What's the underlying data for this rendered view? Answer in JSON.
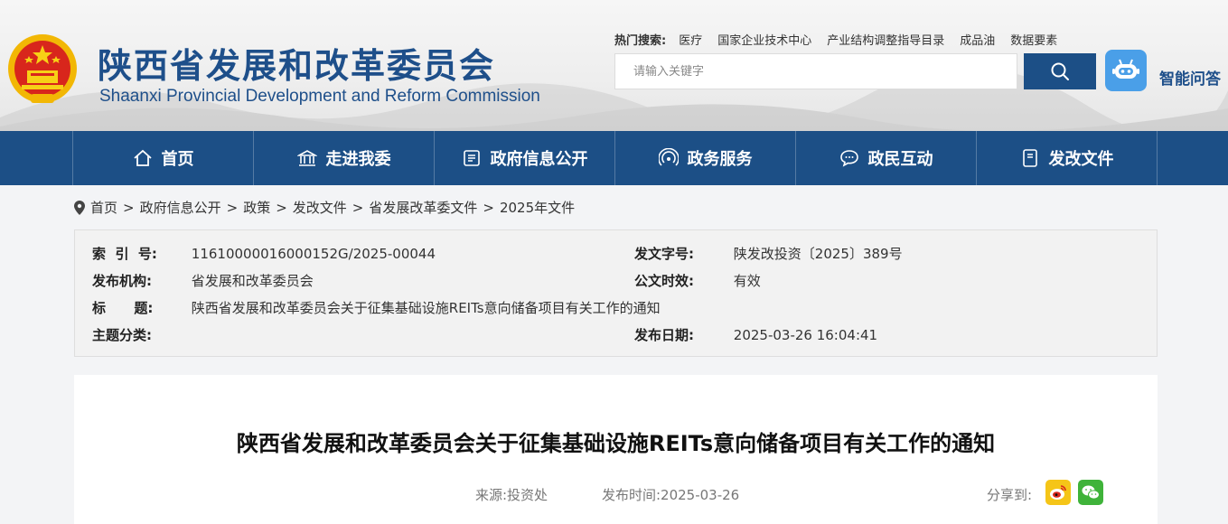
{
  "header": {
    "title_cn": "陕西省发展和改革委员会",
    "title_en": "Shaanxi Provincial Development and Reform Commission",
    "hot_search_label": "热门搜索:",
    "hot_keywords": [
      "医疗",
      "国家企业技术中心",
      "产业结构调整指导目录",
      "成品油",
      "数据要素"
    ],
    "search_placeholder": "请输入关键字",
    "assistant_label": "智能问答"
  },
  "nav": {
    "items": [
      {
        "label": "首页",
        "icon": "home-icon"
      },
      {
        "label": "走进我委",
        "icon": "building-icon"
      },
      {
        "label": "政府信息公开",
        "icon": "document-icon"
      },
      {
        "label": "政务服务",
        "icon": "signal-icon"
      },
      {
        "label": "政民互动",
        "icon": "chat-icon"
      },
      {
        "label": "发改文件",
        "icon": "file-icon"
      }
    ]
  },
  "breadcrumb": [
    "首页",
    "政府信息公开",
    "政策",
    "发改文件",
    "省发展改革委文件",
    "2025年文件"
  ],
  "meta": {
    "index_key": "索  引  号:",
    "index_val": "11610000016000152G/2025-00044",
    "doc_no_key": "发文字号:",
    "doc_no_val": "陕发改投资〔2025〕389号",
    "issuer_key": "发布机构:",
    "issuer_val": "省发展和改革委员会",
    "validity_key": "公文时效:",
    "validity_val": "有效",
    "title_key": "标      题:",
    "title_val": "陕西省发展和改革委员会关于征集基础设施REITs意向储备项目有关工作的通知",
    "topic_key": "主题分类:",
    "topic_val": "",
    "date_key": "发布日期:",
    "date_val": "2025-03-26 16:04:41"
  },
  "article": {
    "title": "陕西省发展和改革委员会关于征集基础设施REITs意向储备项目有关工作的通知",
    "source": "来源:投资处",
    "publish_time": "发布时间:2025-03-26",
    "share_label": "分享到:"
  },
  "colors": {
    "brand_blue": "#1c4f86",
    "title_blue": "#1e4f8a",
    "assistant_blue": "#4a9fe8",
    "weibo_yellow": "#f5c518",
    "wechat_green": "#3fb33a"
  }
}
